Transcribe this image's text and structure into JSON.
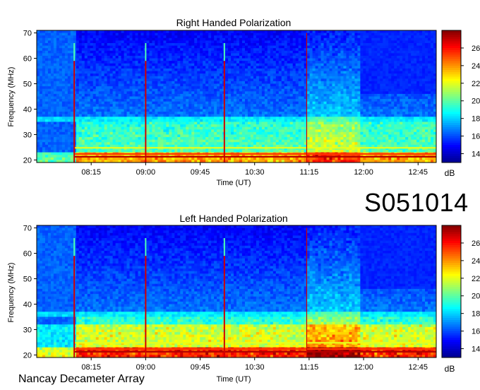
{
  "sidebar_label": "S051014",
  "footer": "Nancay Decameter Array",
  "colors": {
    "colormap": [
      "#00008f",
      "#0000ff",
      "#0080ff",
      "#00ffff",
      "#80ff80",
      "#ffff00",
      "#ff8000",
      "#ff0000",
      "#800000"
    ]
  },
  "chart_data": [
    {
      "type": "heatmap",
      "title": "Right Handed Polarization",
      "xlabel": "Time (UT)",
      "ylabel": "Frequency (MHz)",
      "xticks": [
        "08:15",
        "09:00",
        "09:45",
        "10:30",
        "11:15",
        "12:00",
        "12:45"
      ],
      "ylim": [
        19,
        71
      ],
      "yticks": [
        20,
        30,
        40,
        50,
        60,
        70
      ],
      "colorbar": {
        "label": "dB",
        "ticks": [
          14,
          16,
          18,
          20,
          22,
          24,
          26
        ],
        "range": [
          13,
          28
        ]
      },
      "bursts_ut": [
        "08:01",
        "09:00",
        "10:05",
        "11:13"
      ],
      "grid": false
    },
    {
      "type": "heatmap",
      "title": "Left Handed Polarization",
      "xlabel": "Time (UT)",
      "ylabel": "Frequency (MHz)",
      "xticks": [
        "08:15",
        "09:00",
        "09:45",
        "10:30",
        "11:15",
        "12:00",
        "12:45"
      ],
      "ylim": [
        19,
        71
      ],
      "yticks": [
        20,
        30,
        40,
        50,
        60,
        70
      ],
      "colorbar": {
        "label": "dB",
        "ticks": [
          14,
          16,
          18,
          20,
          22,
          24,
          26
        ],
        "range": [
          13,
          28
        ]
      },
      "bursts_ut": [
        "08:01",
        "09:00",
        "10:05",
        "11:13"
      ],
      "grid": false
    }
  ]
}
